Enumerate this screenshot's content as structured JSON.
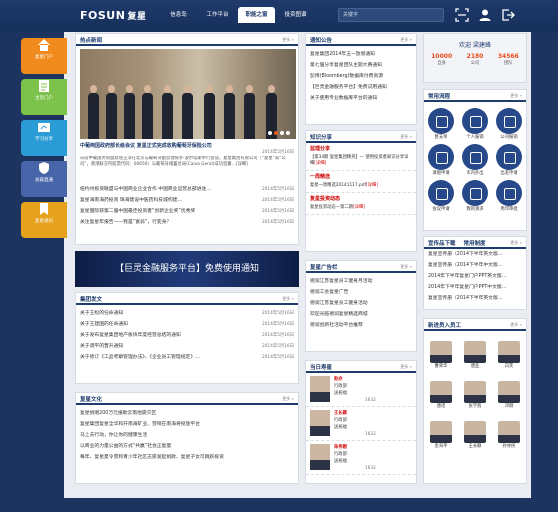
{
  "topbar": {
    "logo": "FOSUN",
    "logo_cn": "复星",
    "nav": [
      "信息岛",
      "工作平台",
      "职能之窗",
      "投资图谱"
    ],
    "active_nav": 2,
    "search_placeholder": "关键字"
  },
  "leftnav": [
    {
      "label": "复星门户",
      "color": "#f08a1d",
      "icon": "home-icon"
    },
    {
      "label": "主页门户",
      "color": "#7cc24b",
      "icon": "document-icon"
    },
    {
      "label": "学习分享",
      "color": "#2b9bd6",
      "icon": "share-icon"
    },
    {
      "label": "总裁直通",
      "color": "#4765a8",
      "icon": "shield-icon"
    },
    {
      "label": "复星通讯",
      "color": "#e6a11d",
      "icon": "bookmark-icon"
    }
  ],
  "news": {
    "title": "热点新闻",
    "more": "更多 »",
    "headline": "中葡两国政府部长级会议 复星正式完成收购葡萄牙保险公司",
    "headline_date": "2014年5月16日",
    "summary": "日前中葡国务院副总理王洋在北京与葡萄牙副总理保罗·波尔塔斯举行会谈，复星集团有限公司（“复星”或“公司”，香港联交所股票代码：00656）与葡萄牙储蓄总局(Caixa Geral)成功签署…[详细]",
    "items": [
      {
        "text": "纽约州投资联盟与中国商业企业合作 中国商业运营总部进驻…",
        "date": "2014年5月16日"
      },
      {
        "text": "复星海南海药投资 珠海建设中医药科技城构建…",
        "date": "2014年5月16日"
      },
      {
        "text": "复星国际获第二届中国最佳投资者“创新企业奖”优秀奖",
        "date": "2014年5月16日"
      },
      {
        "text": "关注复星年报告——我是“富翁”，行变身？",
        "date": "2014年5月16日"
      }
    ]
  },
  "banner": "【巨灵金融服务平台】免费使用通知",
  "appointments": {
    "title": "集团发文",
    "more": "更多 »",
    "items": [
      {
        "text": "关于王松的任命通知",
        "date": "2014年5月16日"
      },
      {
        "text": "关于王建国的任命通知",
        "date": "2014年5月16日"
      },
      {
        "text": "关于发布复星集团地产板块年度经营总结的通知",
        "date": "2014年5月16日"
      },
      {
        "text": "关于调平的晋升通知",
        "date": "2014年5月16日"
      },
      {
        "text": "关于修订《工品考察管理办法》、《企业员工管理规定》…",
        "date": "2014年5月16日"
      }
    ]
  },
  "culture": {
    "title": "复星文化",
    "more": "更多 »",
    "items": [
      "复星捐赠200万元援助云南地震灾区",
      "复星集团复星全华和开南海矿业、营销在南海将投放平台",
      "马上去行动，你让你的健康生活",
      "以商业的力量公益的方式“共赢”社会正能量",
      "每年、复星夏令营和青少年社区志愿发起捐款、复星子女可跳跃投资"
    ]
  },
  "notice": {
    "title": "通知公告",
    "more": "更多 »",
    "items": [
      "复星集团2014年五一放假通知",
      "第七届分享复星团队主题大赛通知",
      "彭博(Bloomberg)数据库付费资源",
      "【巨灵金融服务平台】免费试用通知",
      "关于使用专业数据库平台的通知"
    ]
  },
  "knowledge": {
    "title": "知识分享",
    "more": "更多 »",
    "blocks": [
      {
        "heading": "监理分享",
        "body": "【第34期 复星集团精英】— 使用投资者知识分享详细",
        "link": "[详细]"
      },
      {
        "heading": "一周精选",
        "body": "复星一周精选20141117.pdf",
        "link": "[详细]"
      },
      {
        "heading": "复星投资动态",
        "body": "复星投资动态—第二期",
        "link": "[详细]"
      }
    ]
  },
  "broadcast": {
    "title": "复星广告栏",
    "more": "更多 »",
    "items": [
      "德润江苏复星员工健身月活动",
      "德润工会复星广告",
      "德润江苏复星员工健身活动",
      "欢迎光临德润复星精选商城",
      "德润创新社活动平台推荐"
    ]
  },
  "birthdays": {
    "title": "当日寿星",
    "more": "更多 »",
    "people": [
      {
        "name": "赵亦",
        "dept": "行政部",
        "action": "送祝福",
        "count": "1632"
      },
      {
        "name": "王长颖",
        "dept": "行政部",
        "action": "送祝福",
        "count": "1632"
      },
      {
        "name": "朱伟刚",
        "dept": "行政部",
        "action": "送祝福",
        "count": "1632"
      }
    ]
  },
  "welcome": {
    "greeting": "欢迎 梁建峰",
    "stats": [
      {
        "value": "10000",
        "label": "自身"
      },
      {
        "value": "2180",
        "label": "公司"
      },
      {
        "value": "34566",
        "label": "团队"
      }
    ]
  },
  "processes": {
    "title": "常用流程",
    "more": "更多 »",
    "items": [
      "暂支单",
      "个人报销",
      "公司报销",
      "请假申请",
      "市内外出",
      "出差申请",
      "会议申请",
      "我的请求",
      "用印审批"
    ]
  },
  "downloads": {
    "tabs": [
      "宣传品下载",
      "常用制度"
    ],
    "more": "更多 »",
    "items": [
      "复星宣传册（2014下半年英文版…",
      "复星宣传册（2014下半年中文版…",
      "2014年下半年复星门户PPT英文版…",
      "2014年下半年复星门户PPT中文版…",
      "复星宣传册（2014下半年英文版…"
    ]
  },
  "newcomers": {
    "title": "新进员入员工",
    "more": "更多 »",
    "people": [
      "曹荣华",
      "唐亚",
      "白芙",
      "唐诺",
      "张学茜",
      "邓刚",
      "金海平",
      "王长颖",
      "孙亦民"
    ]
  },
  "colors": {
    "accent": "#1e3c6e",
    "highlight": "#c00000",
    "stat": "#e84b1b"
  }
}
